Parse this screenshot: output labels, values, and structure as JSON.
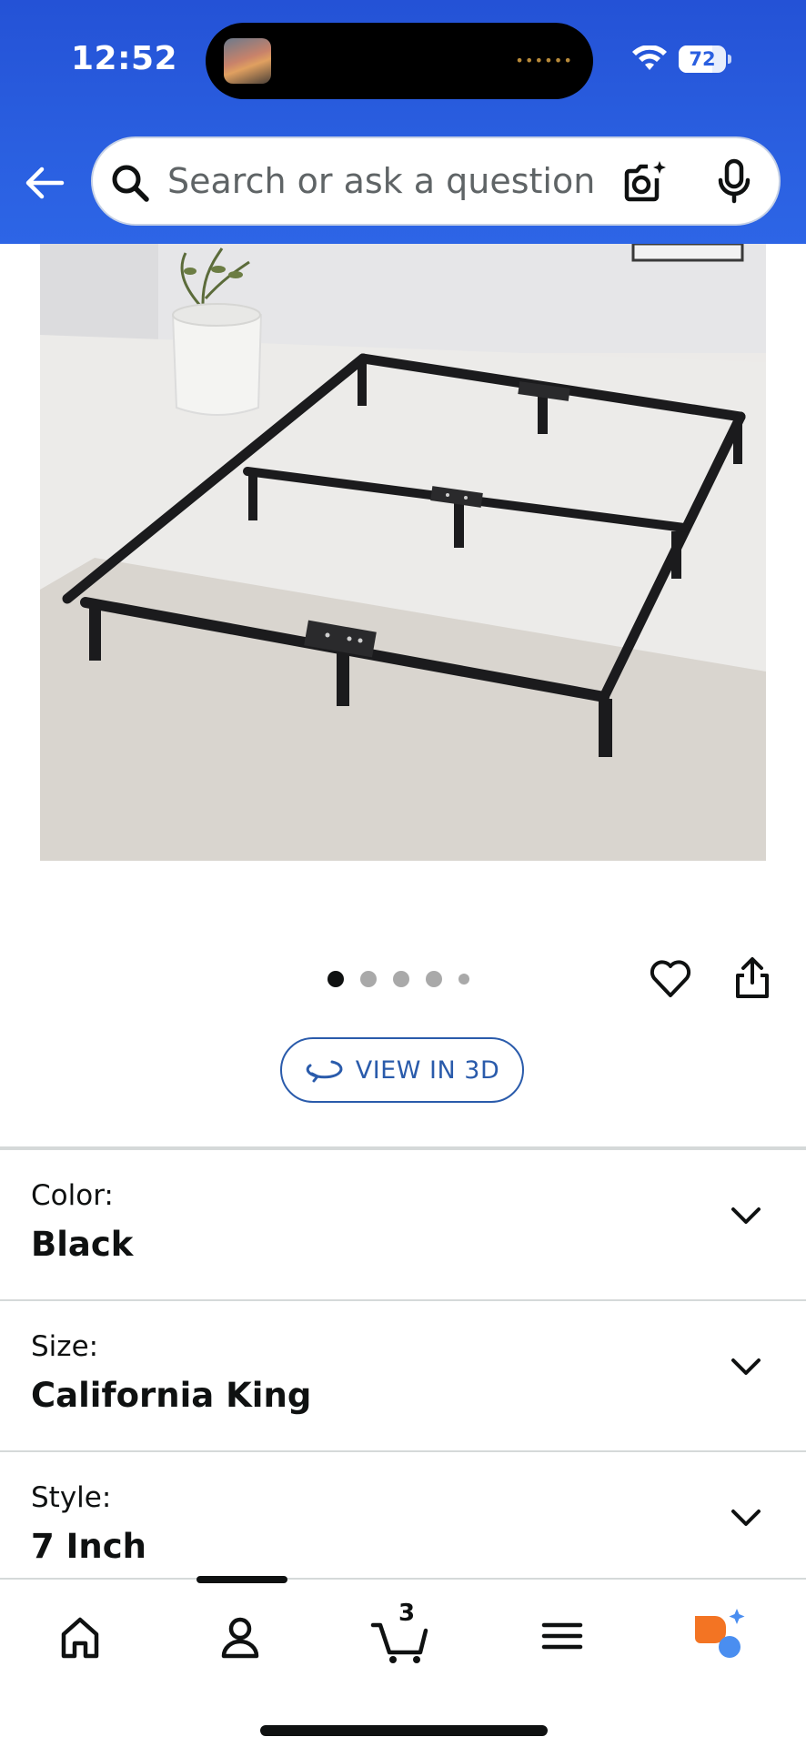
{
  "status_bar": {
    "time": "12:52",
    "battery": "72",
    "battery_level": 0.72,
    "icons": [
      "wifi-icon",
      "battery-icon"
    ]
  },
  "header": {
    "search_placeholder": "Search or ask a question",
    "icons": [
      "back-arrow-icon",
      "search-icon",
      "camera-icon",
      "mic-icon"
    ]
  },
  "carousel": {
    "total_images": 5,
    "active_index": 0
  },
  "view_3d": {
    "label": "VIEW IN 3D"
  },
  "variations": [
    {
      "label": "Color:",
      "value": "Black"
    },
    {
      "label": "Size:",
      "value": "California King"
    },
    {
      "label": "Style:",
      "value": "7 Inch"
    }
  ],
  "bottom_nav": {
    "cart_count": "3",
    "items": [
      "home-icon",
      "account-icon",
      "cart-icon",
      "menu-icon",
      "rufus-icon"
    ]
  },
  "colors": {
    "header_blue": "#2a5fe0",
    "link_blue": "#2a5bab",
    "text": "#0f1111",
    "rufus_orange": "#f37423",
    "rufus_blue": "#4a8ef0"
  }
}
